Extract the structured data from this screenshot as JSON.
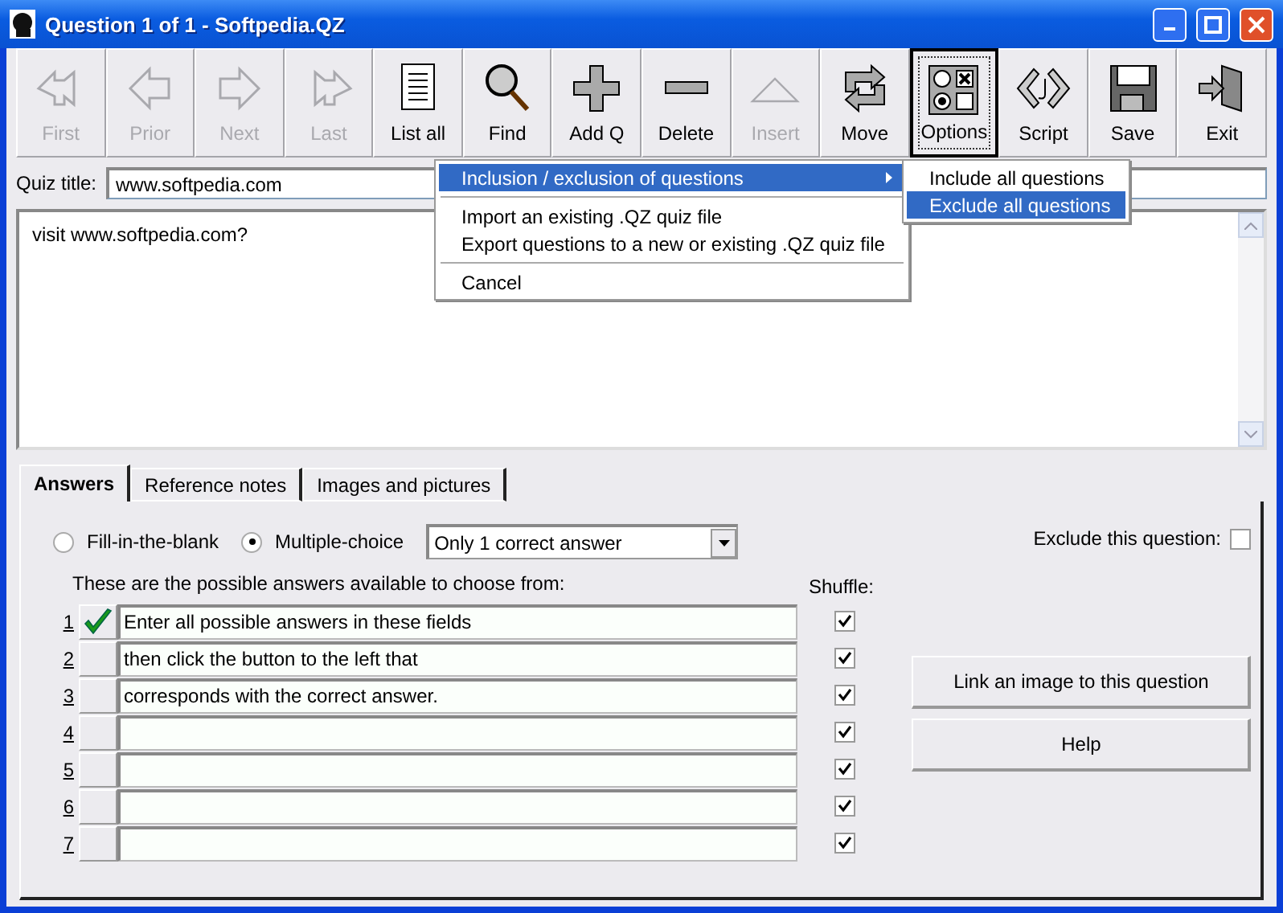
{
  "window": {
    "title": "Question 1 of 1 - Softpedia.QZ"
  },
  "toolbar": [
    {
      "label": "First",
      "disabled": true,
      "pressed": false
    },
    {
      "label": "Prior",
      "disabled": true,
      "pressed": false
    },
    {
      "label": "Next",
      "disabled": true,
      "pressed": false
    },
    {
      "label": "Last",
      "disabled": true,
      "pressed": false
    },
    {
      "label": "List all",
      "disabled": false,
      "pressed": false
    },
    {
      "label": "Find",
      "disabled": false,
      "pressed": false
    },
    {
      "label": "Add Q",
      "disabled": false,
      "pressed": false
    },
    {
      "label": "Delete",
      "disabled": false,
      "pressed": false
    },
    {
      "label": "Insert",
      "disabled": true,
      "pressed": false
    },
    {
      "label": "Move",
      "disabled": false,
      "pressed": false
    },
    {
      "label": "Options",
      "disabled": false,
      "pressed": true
    },
    {
      "label": "Script",
      "disabled": false,
      "pressed": false
    },
    {
      "label": "Save",
      "disabled": false,
      "pressed": false
    },
    {
      "label": "Exit",
      "disabled": false,
      "pressed": false
    }
  ],
  "quiz_title": {
    "label": "Quiz title:",
    "value": "www.softpedia.com"
  },
  "question": {
    "value": "visit www.softpedia.com?"
  },
  "menu": {
    "items": [
      {
        "kind": "item",
        "label": "Inclusion / exclusion of questions",
        "highlighted": true,
        "submenu": true
      },
      {
        "kind": "separator"
      },
      {
        "kind": "item",
        "label": "Import an existing .QZ quiz file",
        "highlighted": false,
        "submenu": false
      },
      {
        "kind": "item",
        "label": "Export questions to a new or existing .QZ quiz file",
        "highlighted": false,
        "submenu": false
      },
      {
        "kind": "separator"
      },
      {
        "kind": "item",
        "label": "Cancel",
        "highlighted": false,
        "submenu": false
      }
    ],
    "submenu": [
      {
        "label": "Include all questions",
        "highlighted": false
      },
      {
        "label": "Exclude all questions",
        "highlighted": true
      }
    ]
  },
  "tabs": [
    {
      "label": "Answers",
      "selected": true
    },
    {
      "label": "Reference notes",
      "selected": false
    },
    {
      "label": "Images and pictures",
      "selected": false
    }
  ],
  "mode_options": [
    {
      "label": "Fill-in-the-blank",
      "selected": false
    },
    {
      "label": "Multiple-choice",
      "selected": true
    }
  ],
  "answer_mode": {
    "value": "Only 1 correct answer"
  },
  "exclude_question": {
    "label": "Exclude this question:",
    "checked": false
  },
  "answers_caption": "These are the possible answers available to choose from:",
  "shuffle_label": "Shuffle:",
  "answers": [
    {
      "number": "1",
      "text": "Enter all possible answers in these fields",
      "correct": true,
      "shuffle": true
    },
    {
      "number": "2",
      "text": "then click the button to the left that",
      "correct": false,
      "shuffle": true
    },
    {
      "number": "3",
      "text": "corresponds with the correct answer.",
      "correct": false,
      "shuffle": true
    },
    {
      "number": "4",
      "correct": false,
      "shuffle": true
    },
    {
      "number": "5",
      "correct": false,
      "shuffle": true
    },
    {
      "number": "6",
      "correct": false,
      "shuffle": true
    },
    {
      "number": "7",
      "correct": false,
      "shuffle": true
    }
  ],
  "buttons": [
    "Link an image to this question",
    "Help"
  ]
}
